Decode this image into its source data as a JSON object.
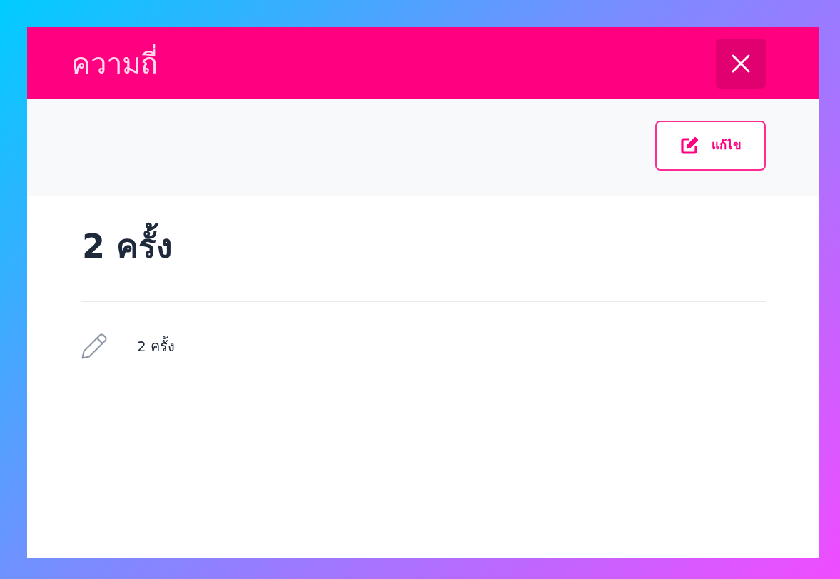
{
  "dialog": {
    "title": "ความถี่"
  },
  "toolbar": {
    "edit_button": {
      "label": "แก้ไข"
    }
  },
  "heading": "2 ครั้ง",
  "details": [
    {
      "value": "2 ครั้ง"
    }
  ]
}
